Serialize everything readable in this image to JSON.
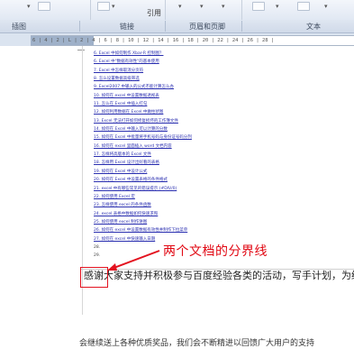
{
  "ribbon": {
    "buttons": [
      "引用"
    ],
    "groups": [
      "插图",
      "链接",
      "页眉和页脚",
      "文本"
    ]
  },
  "ruler": {
    "scale": "6 | 4 | 2 | L | 2 | 4 | 6 | 8 | 10 | 12 | 14 | 16 | 18 | 20 | 22 | 24 | 26 | 28 |"
  },
  "document": {
    "links": [
      "6. Excel 中如何制作 Xbar-R 控制图？",
      "6. Excel 中\"数据有效性\"的基本使用",
      "7. Excel 中怎样取消分页符",
      "8. 怎么设置数据高级筛选",
      "9. Excel2007 中输入的公式不能计算怎么办",
      "10. 如何在 excel 中设置数据透视表",
      "11. 怎么在 Excel 中插入打勾",
      "12. 如何利用数据在 Excel 中做柱状图",
      "13. Excel 无法打开如何修复损坏的工作簿文件",
      "14. 如何在 Excel 中输入可以计算的分数",
      "15. 如何在 Excel 中批量将手机号码与身份证号码分列",
      "16. 如何在 excel 里面插入 word 文档内容",
      "17. 怎样将高版本的 Excel 文件",
      "18. 怎样用 Excel 设计出好看的表格",
      "19. 如何在 Excel 中设计公式",
      "20. 如何在 Excel 中设置表格的条件格式",
      "21. excel 中有哪些常见的错误提示 (#DIV/0)",
      "22. 如何使用 Excel 宏",
      "23. 怎样使用 excel 的条件函数",
      "24. excel 表格中数据如何快速求和",
      "25. 如何使用 excel 制作饼图",
      "26. 如何在 excel 中设置数据有效性并制作下拉菜单",
      "27. 如何在 excel 中快速输入日期",
      "28.",
      "29."
    ],
    "body_line1": "感谢大家支持并积极参与百度经验各类的活动，写手计划，为经验",
    "body_line2": "会继续送上各种优质奖品，我们会不断精进以回馈广大用户的支持"
  },
  "annotation": {
    "label": "两个文档的分界线",
    "color": "#e10712"
  }
}
